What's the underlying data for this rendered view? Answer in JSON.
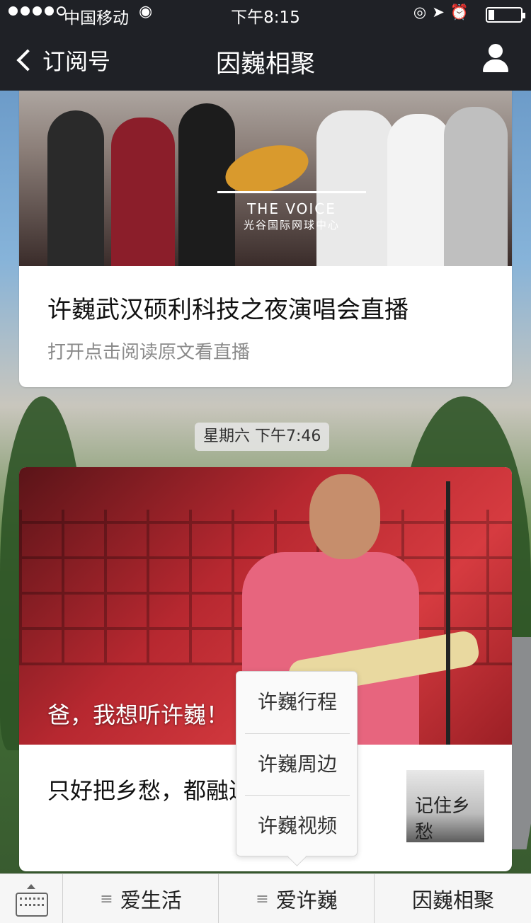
{
  "status_bar": {
    "carrier": "中国移动",
    "time": "下午8:15"
  },
  "nav": {
    "back_label": "订阅号",
    "title": "因巍相聚"
  },
  "feed": {
    "article_card": {
      "title": "许巍武汉硕利科技之夜演唱会直播",
      "subtitle": "打开点击阅读原文看直播",
      "image_text": "THE VOICE",
      "image_subtext": "光谷国际网球中心"
    },
    "timestamp": "星期六 下午7:46",
    "article_card_2": {
      "caption": "爸，我想听许巍！",
      "text": "只好把乡愁，都融进 留在心间",
      "thumb_text": "记住乡愁"
    }
  },
  "popup_menu": {
    "items": [
      "许巍行程",
      "许巍周边",
      "许巍视频"
    ]
  },
  "menubar": {
    "tabs": [
      "爱生活",
      "爱许巍",
      "因巍相聚"
    ],
    "menu_glyph": "≡"
  }
}
